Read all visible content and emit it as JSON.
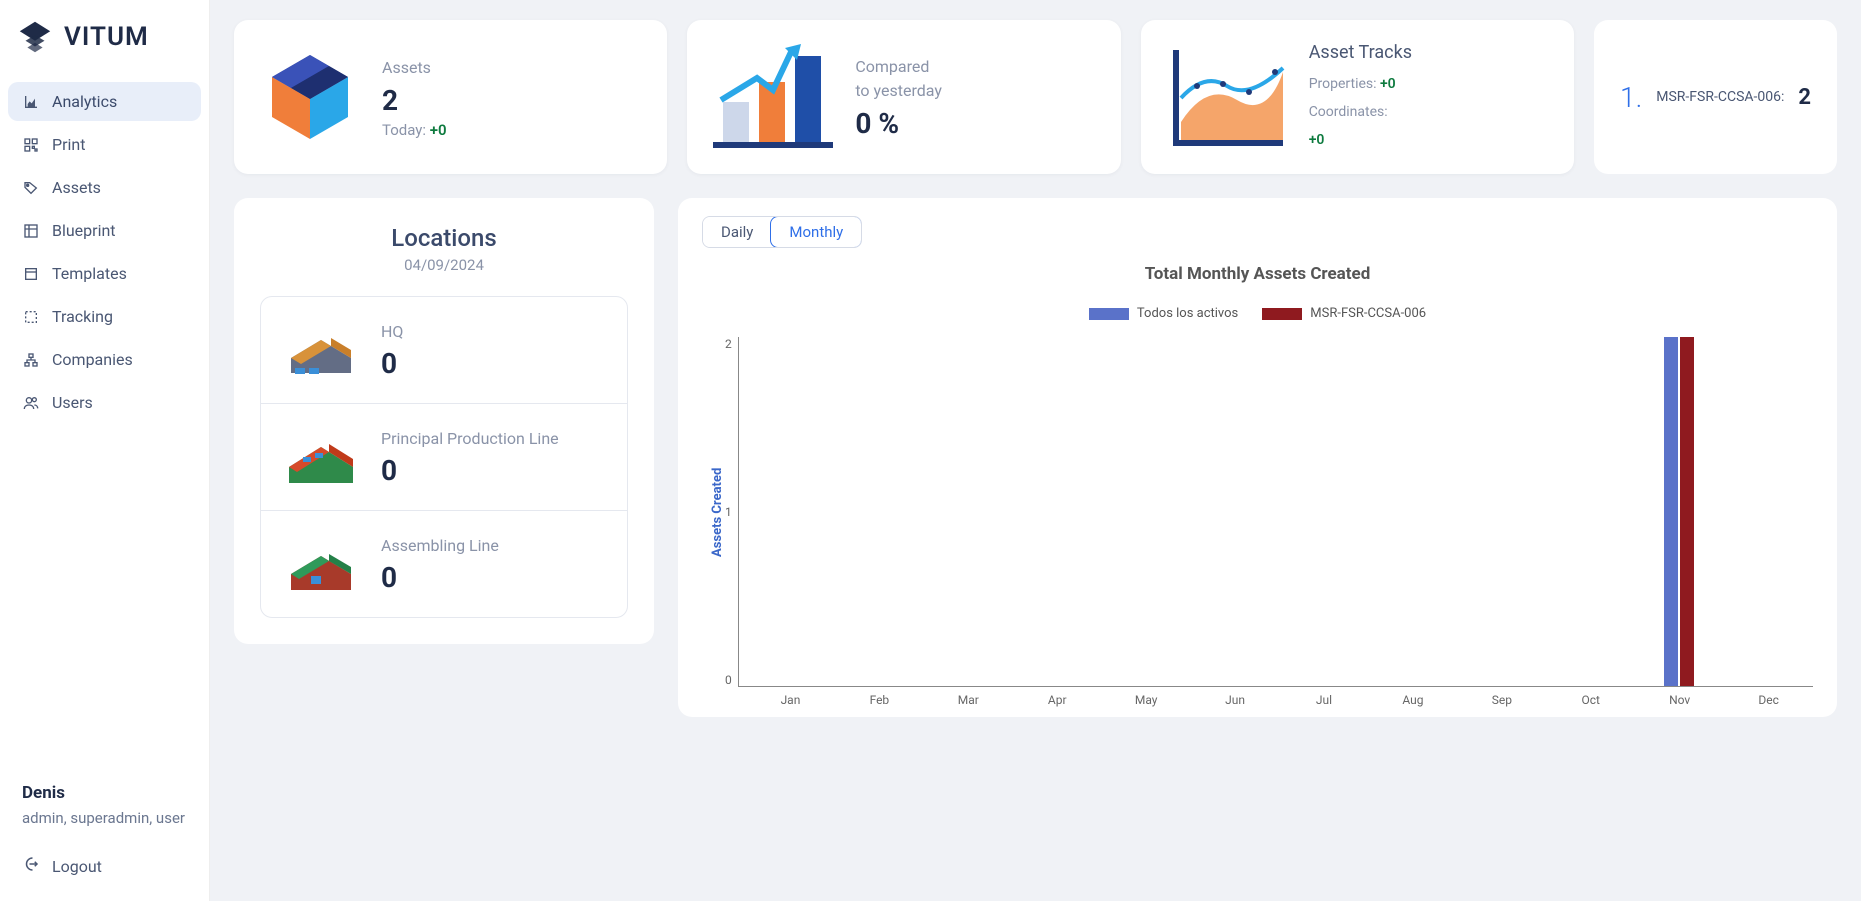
{
  "brand": "VITUM",
  "nav": [
    {
      "label": "Analytics",
      "icon": "chart-line-icon",
      "active": true
    },
    {
      "label": "Print",
      "icon": "qr-icon",
      "active": false
    },
    {
      "label": "Assets",
      "icon": "tag-icon",
      "active": false
    },
    {
      "label": "Blueprint",
      "icon": "blueprint-icon",
      "active": false
    },
    {
      "label": "Templates",
      "icon": "templates-icon",
      "active": false
    },
    {
      "label": "Tracking",
      "icon": "tracking-icon",
      "active": false
    },
    {
      "label": "Companies",
      "icon": "sitemap-icon",
      "active": false
    },
    {
      "label": "Users",
      "icon": "users-icon",
      "active": false
    }
  ],
  "user": {
    "name": "Denis",
    "roles": "admin, superadmin, user"
  },
  "logout_label": "Logout",
  "stats": {
    "assets_label": "Assets",
    "assets_value": "2",
    "today_label": "Today: ",
    "today_delta": "+0",
    "compared_line1": "Compared",
    "compared_line2": "to yesterday",
    "compared_value": "0 %",
    "tracks_title": "Asset Tracks",
    "tracks_props_label": "Properties: ",
    "tracks_props_delta": "+0",
    "tracks_coords_label": "Coordinates:",
    "tracks_coords_delta": "+0"
  },
  "rank": {
    "index": "1.",
    "label": "MSR-FSR-CCSA-006:",
    "value": "2"
  },
  "locations": {
    "title": "Locations",
    "date": "04/09/2024",
    "items": [
      {
        "name": "HQ",
        "count": "0"
      },
      {
        "name": "Principal Production Line",
        "count": "0"
      },
      {
        "name": "Assembling Line",
        "count": "0"
      }
    ]
  },
  "chart": {
    "tab_daily": "Daily",
    "tab_monthly": "Monthly",
    "title": "Total Monthly Assets Created",
    "legend": {
      "all": "Todos los activos",
      "series2": "MSR-FSR-CCSA-006"
    },
    "ylabel": "Assets Created",
    "ymax": 2,
    "yticks": [
      "2",
      "1",
      "0"
    ],
    "colors": {
      "all": "#5a72c9",
      "s2": "#8f1a1f"
    }
  },
  "chart_data": {
    "type": "bar",
    "title": "Total Monthly Assets Created",
    "ylabel": "Assets Created",
    "xlabel": "",
    "ylim": [
      0,
      2
    ],
    "categories": [
      "Jan",
      "Feb",
      "Mar",
      "Apr",
      "May",
      "Jun",
      "Jul",
      "Aug",
      "Sep",
      "Oct",
      "Nov",
      "Dec"
    ],
    "series": [
      {
        "name": "Todos los activos",
        "color": "#5a72c9",
        "values": [
          0,
          0,
          0,
          0,
          0,
          0,
          0,
          0,
          0,
          0,
          2,
          0
        ]
      },
      {
        "name": "MSR-FSR-CCSA-006",
        "color": "#8f1a1f",
        "values": [
          0,
          0,
          0,
          0,
          0,
          0,
          0,
          0,
          0,
          0,
          2,
          0
        ]
      }
    ]
  }
}
